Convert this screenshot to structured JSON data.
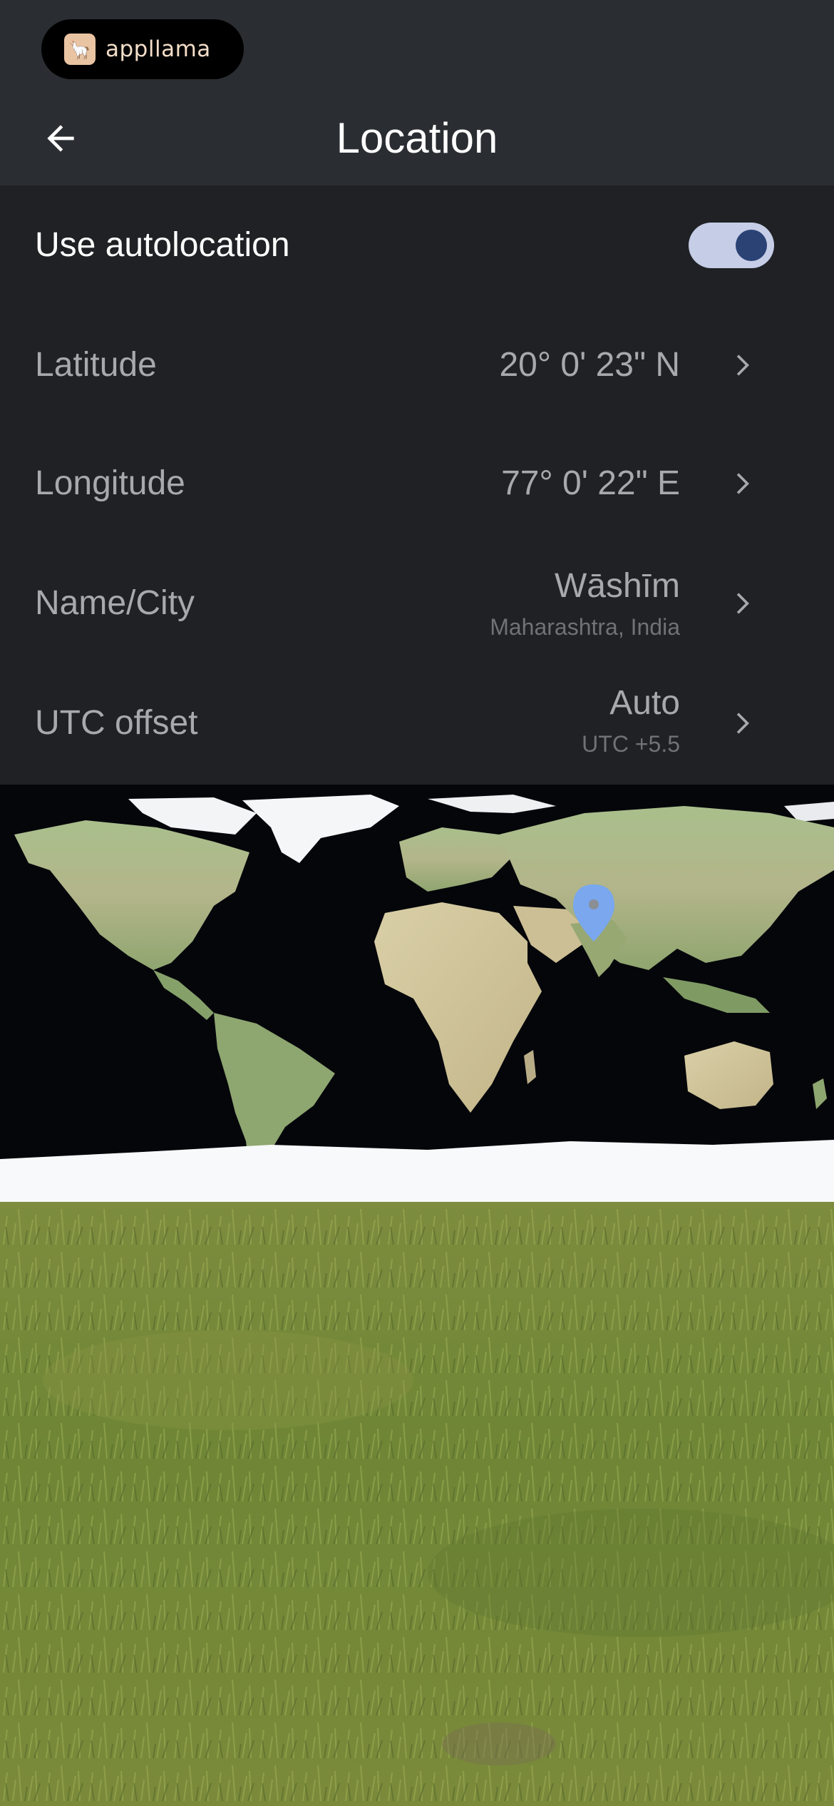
{
  "app": {
    "brand_name": "appllama",
    "title": "Location"
  },
  "settings": {
    "autolocation": {
      "label": "Use autolocation",
      "enabled": true
    },
    "latitude": {
      "label": "Latitude",
      "value": "20° 0' 23\" N"
    },
    "longitude": {
      "label": "Longitude",
      "value": "77° 0' 22\" E"
    },
    "city": {
      "label": "Name/City",
      "value": "Wāshīm",
      "sub": "Maharashtra, India"
    },
    "utc": {
      "label": "UTC offset",
      "value": "Auto",
      "sub": "UTC +5.5"
    }
  },
  "colors": {
    "background": "#1f2124",
    "topbar": "#2a2d31",
    "toggle_track": "#c6cde6",
    "toggle_knob": "#2b4275",
    "pin": "#7aa7ee"
  },
  "icons": {
    "back": "arrow-left-icon",
    "chevron": "chevron-right-icon",
    "pin": "map-pin-icon"
  }
}
